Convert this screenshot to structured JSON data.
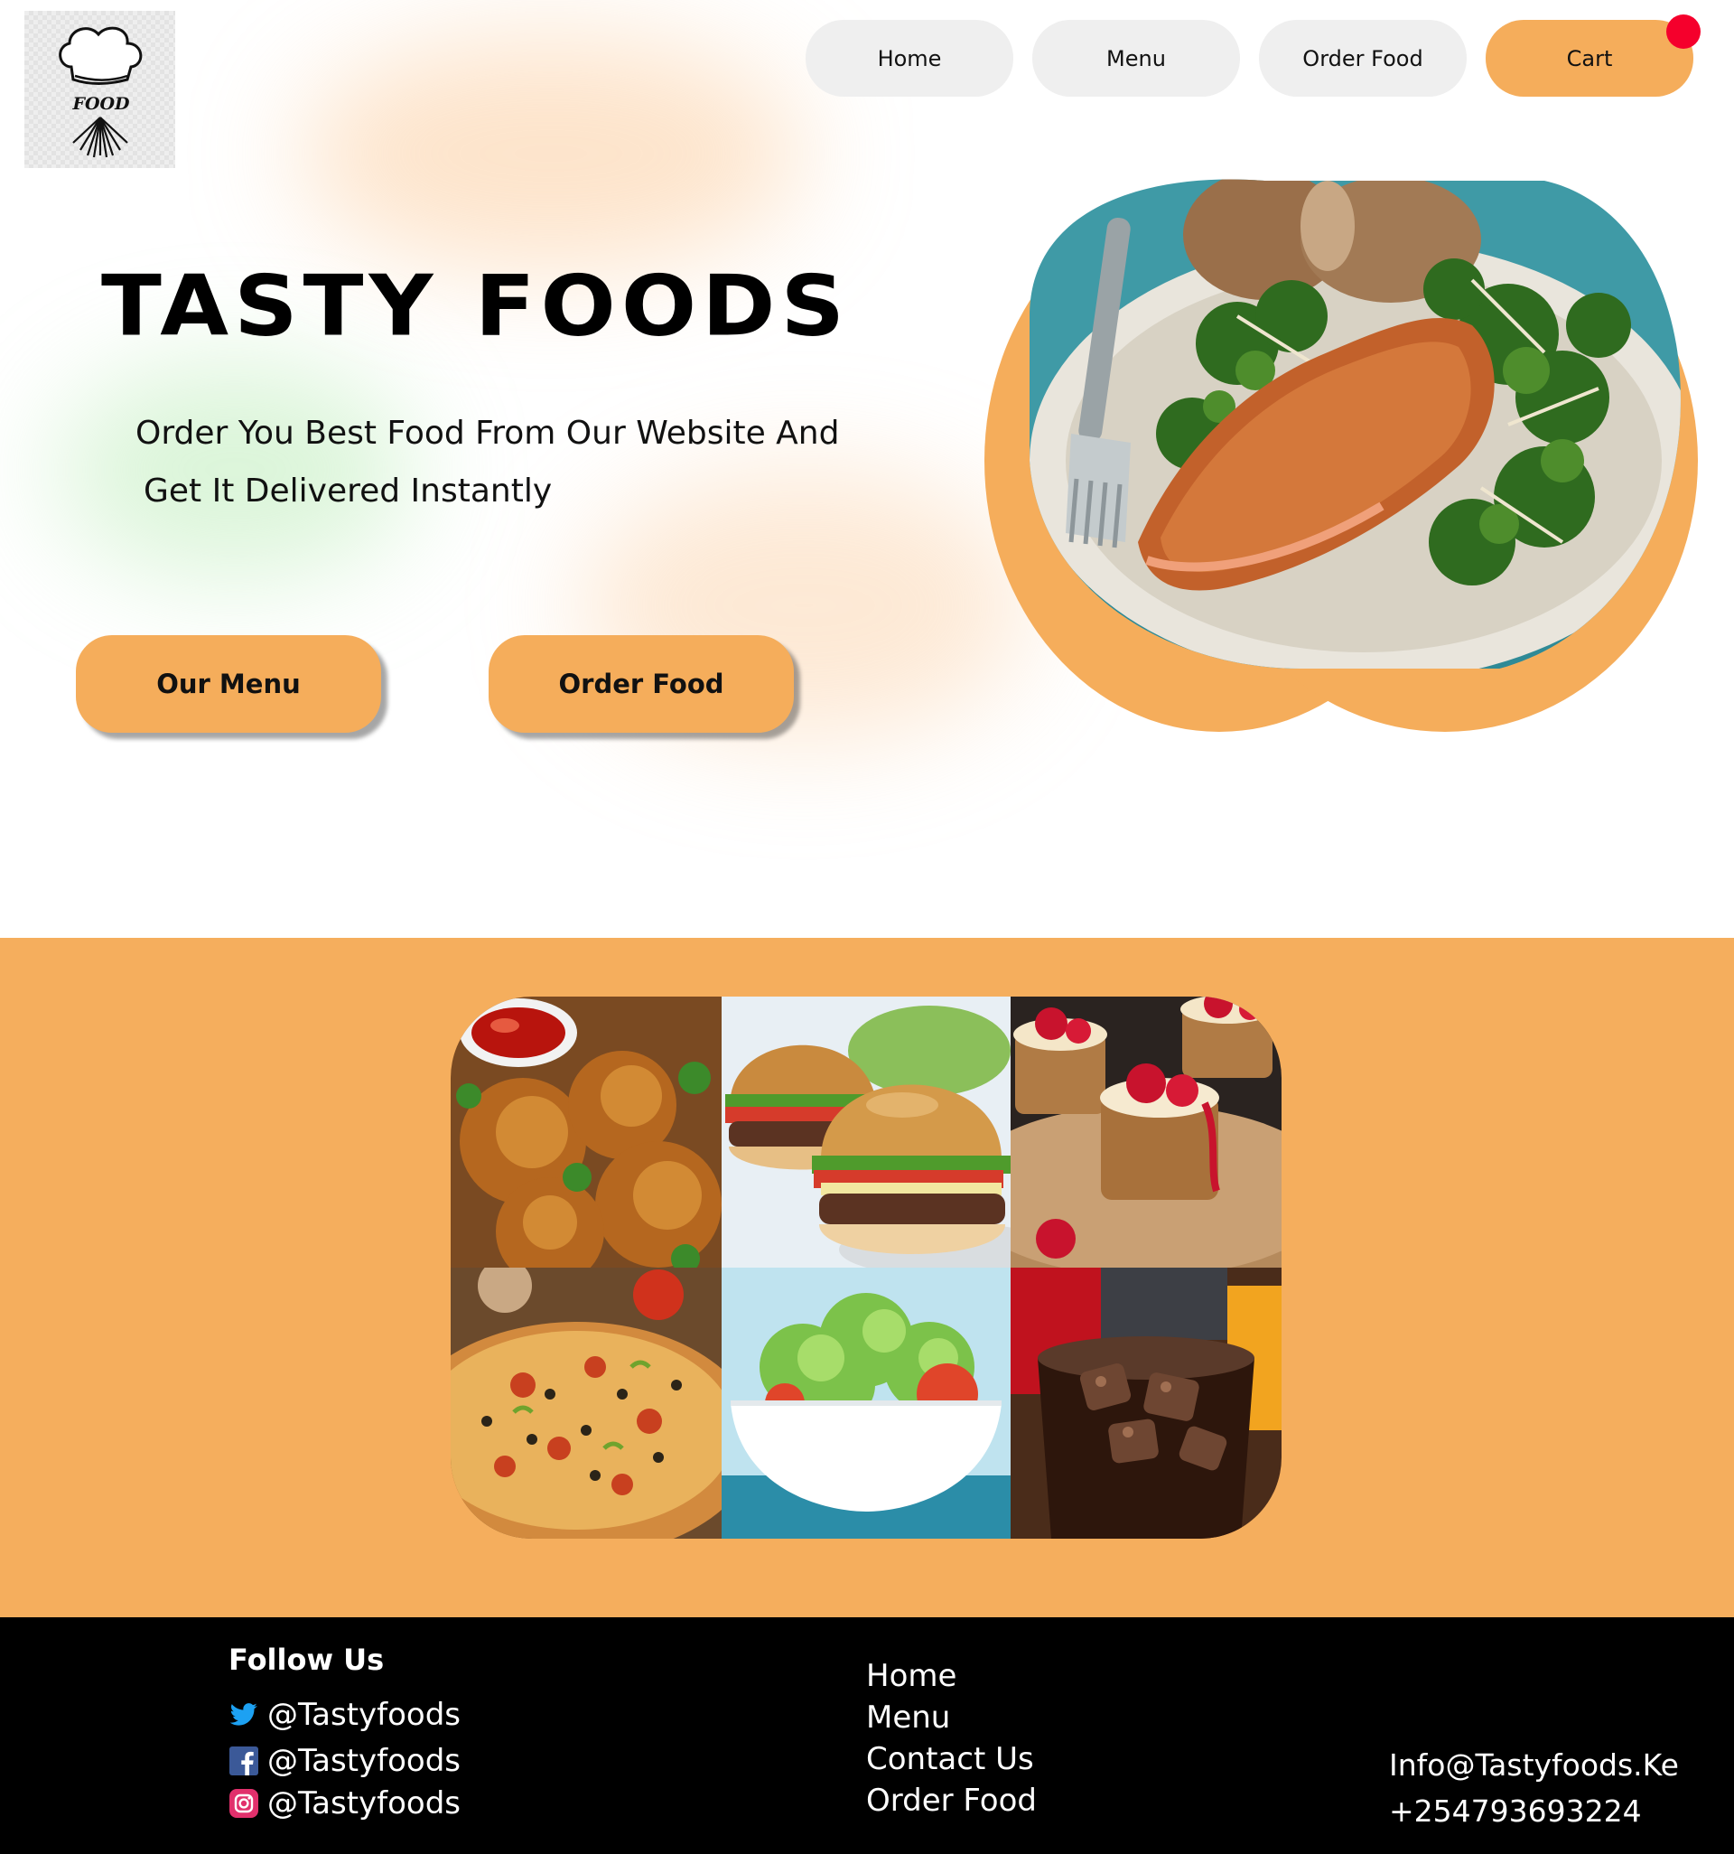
{
  "logo": {
    "text": "FOOD"
  },
  "nav": {
    "items": [
      {
        "label": "Home"
      },
      {
        "label": "Menu"
      },
      {
        "label": "Order Food"
      },
      {
        "label": "Cart"
      }
    ]
  },
  "hero": {
    "title": "TASTY FOODS",
    "subtitle_line1": "Order You Best Food From Our Website And",
    "subtitle_line2": "Get It Delivered Instantly",
    "cta_menu": "Our Menu",
    "cta_order": "Order Food"
  },
  "colors": {
    "accent": "#f5ad5b",
    "badge": "#f5002c",
    "footer_bg": "#000000",
    "nav_bg": "#efefef"
  },
  "gallery": {
    "items": [
      {
        "icon": "fried-chicken-icon"
      },
      {
        "icon": "burger-icon"
      },
      {
        "icon": "cheesecake-icon"
      },
      {
        "icon": "pizza-icon"
      },
      {
        "icon": "salad-icon"
      },
      {
        "icon": "soda-icon"
      }
    ]
  },
  "footer": {
    "follow_title": "Follow Us",
    "socials": [
      {
        "icon": "twitter-icon",
        "handle": "@Tastyfoods"
      },
      {
        "icon": "facebook-icon",
        "handle": "@Tastyfoods"
      },
      {
        "icon": "instagram-icon",
        "handle": "@Tastyfoods"
      }
    ],
    "links": [
      "Home",
      "Menu",
      "Contact Us",
      "Order Food"
    ],
    "email": "Info@Tastyfoods.Ke",
    "phone": "+254793693224"
  }
}
